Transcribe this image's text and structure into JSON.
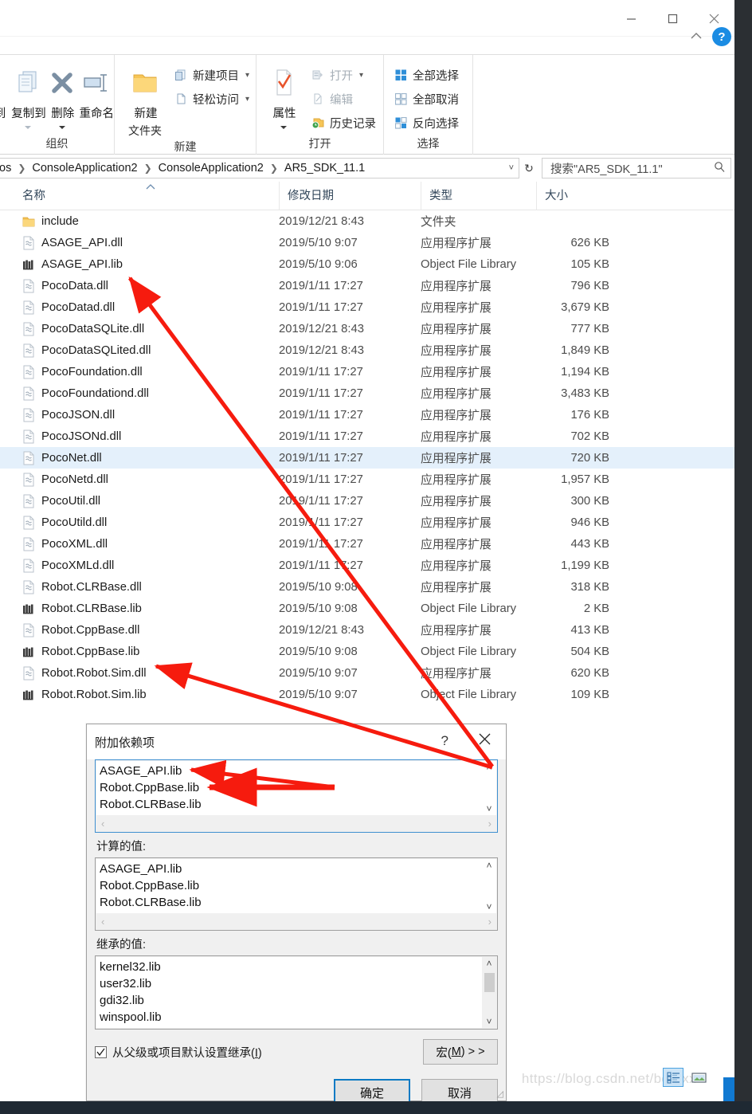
{
  "window": {
    "controls": {
      "minimize": "minimize-icon",
      "maximize": "maximize-icon",
      "close": "close-icon"
    },
    "collapse_ribbon": "chevron-up-icon",
    "help": "?"
  },
  "ribbon": {
    "groups": [
      {
        "label": "组织",
        "big_buttons": [
          {
            "name": "move-to",
            "label_line1": "到",
            "label_line2": "",
            "icon": "move-to-icon",
            "dropdown": true,
            "dim": true
          },
          {
            "name": "copy-to",
            "label_line1": "复制到",
            "label_line2": "",
            "icon": "copy-to-icon",
            "dropdown": true,
            "dim": true
          },
          {
            "name": "delete",
            "label_line1": "删除",
            "label_line2": "",
            "icon": "delete-x-icon",
            "dropdown": true,
            "dim": false
          },
          {
            "name": "rename",
            "label_line1": "重命名",
            "label_line2": "",
            "icon": "rename-icon",
            "dropdown": false,
            "dim": false
          }
        ]
      },
      {
        "label": "新建",
        "big_buttons": [
          {
            "name": "new-folder",
            "label_line1": "新建",
            "label_line2": "文件夹",
            "icon": "folder-icon",
            "dropdown": false,
            "dim": false
          }
        ],
        "small_buttons": [
          {
            "name": "new-item",
            "label": "新建项目",
            "icon": "new-item-icon",
            "dropdown": true,
            "dim": false
          },
          {
            "name": "easy-access",
            "label": "轻松访问",
            "icon": "easy-access-icon",
            "dropdown": true,
            "dim": false
          }
        ]
      },
      {
        "label": "打开",
        "big_buttons": [
          {
            "name": "properties",
            "label_line1": "属性",
            "label_line2": "",
            "icon": "properties-icon",
            "dropdown": true,
            "dim": false
          }
        ],
        "small_buttons": [
          {
            "name": "open",
            "label": "打开",
            "icon": "open-icon",
            "dropdown": true,
            "dim": true
          },
          {
            "name": "edit",
            "label": "编辑",
            "icon": "edit-icon",
            "dropdown": false,
            "dim": true
          },
          {
            "name": "history",
            "label": "历史记录",
            "icon": "history-icon",
            "dropdown": false,
            "dim": false
          }
        ]
      },
      {
        "label": "选择",
        "small_buttons": [
          {
            "name": "select-all",
            "label": "全部选择",
            "icon": "select-all-icon",
            "dropdown": false,
            "dim": false
          },
          {
            "name": "select-none",
            "label": "全部取消",
            "icon": "select-none-icon",
            "dropdown": false,
            "dim": false
          },
          {
            "name": "invert-selection",
            "label": "反向选择",
            "icon": "invert-selection-icon",
            "dropdown": false,
            "dim": false
          }
        ]
      }
    ]
  },
  "address_bar": {
    "crumbs": [
      "os",
      "ConsoleApplication2",
      "ConsoleApplication2",
      "AR5_SDK_11.1"
    ],
    "dropdown_icon": "chevron-down-icon",
    "refresh_icon": "refresh-icon"
  },
  "search": {
    "value": "搜索\"AR5_SDK_11.1\"",
    "icon": "search-icon"
  },
  "columns": [
    {
      "key": "name",
      "label": "名称",
      "sorted": true,
      "sort_dir": "asc"
    },
    {
      "key": "date",
      "label": "修改日期"
    },
    {
      "key": "type",
      "label": "类型"
    },
    {
      "key": "size",
      "label": "大小"
    }
  ],
  "files": [
    {
      "name": "include",
      "date": "2019/12/21 8:43",
      "type": "文件夹",
      "size": "",
      "icon": "folder-icon",
      "selected": false
    },
    {
      "name": "ASAGE_API.dll",
      "date": "2019/5/10 9:07",
      "type": "应用程序扩展",
      "size": "626 KB",
      "icon": "dll-icon",
      "selected": false
    },
    {
      "name": "ASAGE_API.lib",
      "date": "2019/5/10 9:06",
      "type": "Object File Library",
      "size": "105 KB",
      "icon": "lib-icon",
      "selected": false
    },
    {
      "name": "PocoData.dll",
      "date": "2019/1/11 17:27",
      "type": "应用程序扩展",
      "size": "796 KB",
      "icon": "dll-icon",
      "selected": false
    },
    {
      "name": "PocoDatad.dll",
      "date": "2019/1/11 17:27",
      "type": "应用程序扩展",
      "size": "3,679 KB",
      "icon": "dll-icon",
      "selected": false
    },
    {
      "name": "PocoDataSQLite.dll",
      "date": "2019/12/21 8:43",
      "type": "应用程序扩展",
      "size": "777 KB",
      "icon": "dll-icon",
      "selected": false
    },
    {
      "name": "PocoDataSQLited.dll",
      "date": "2019/12/21 8:43",
      "type": "应用程序扩展",
      "size": "1,849 KB",
      "icon": "dll-icon",
      "selected": false
    },
    {
      "name": "PocoFoundation.dll",
      "date": "2019/1/11 17:27",
      "type": "应用程序扩展",
      "size": "1,194 KB",
      "icon": "dll-icon",
      "selected": false
    },
    {
      "name": "PocoFoundationd.dll",
      "date": "2019/1/11 17:27",
      "type": "应用程序扩展",
      "size": "3,483 KB",
      "icon": "dll-icon",
      "selected": false
    },
    {
      "name": "PocoJSON.dll",
      "date": "2019/1/11 17:27",
      "type": "应用程序扩展",
      "size": "176 KB",
      "icon": "dll-icon",
      "selected": false
    },
    {
      "name": "PocoJSONd.dll",
      "date": "2019/1/11 17:27",
      "type": "应用程序扩展",
      "size": "702 KB",
      "icon": "dll-icon",
      "selected": false
    },
    {
      "name": "PocoNet.dll",
      "date": "2019/1/11 17:27",
      "type": "应用程序扩展",
      "size": "720 KB",
      "icon": "dll-icon",
      "selected": true
    },
    {
      "name": "PocoNetd.dll",
      "date": "2019/1/11 17:27",
      "type": "应用程序扩展",
      "size": "1,957 KB",
      "icon": "dll-icon",
      "selected": false
    },
    {
      "name": "PocoUtil.dll",
      "date": "2019/1/11 17:27",
      "type": "应用程序扩展",
      "size": "300 KB",
      "icon": "dll-icon",
      "selected": false
    },
    {
      "name": "PocoUtild.dll",
      "date": "2019/1/11 17:27",
      "type": "应用程序扩展",
      "size": "946 KB",
      "icon": "dll-icon",
      "selected": false
    },
    {
      "name": "PocoXML.dll",
      "date": "2019/1/11 17:27",
      "type": "应用程序扩展",
      "size": "443 KB",
      "icon": "dll-icon",
      "selected": false
    },
    {
      "name": "PocoXMLd.dll",
      "date": "2019/1/11 17:27",
      "type": "应用程序扩展",
      "size": "1,199 KB",
      "icon": "dll-icon",
      "selected": false
    },
    {
      "name": "Robot.CLRBase.dll",
      "date": "2019/5/10 9:08",
      "type": "应用程序扩展",
      "size": "318 KB",
      "icon": "dll-icon",
      "selected": false
    },
    {
      "name": "Robot.CLRBase.lib",
      "date": "2019/5/10 9:08",
      "type": "Object File Library",
      "size": "2 KB",
      "icon": "lib-icon",
      "selected": false
    },
    {
      "name": "Robot.CppBase.dll",
      "date": "2019/12/21 8:43",
      "type": "应用程序扩展",
      "size": "413 KB",
      "icon": "dll-icon",
      "selected": false
    },
    {
      "name": "Robot.CppBase.lib",
      "date": "2019/5/10 9:08",
      "type": "Object File Library",
      "size": "504 KB",
      "icon": "lib-icon",
      "selected": false
    },
    {
      "name": "Robot.Robot.Sim.dll",
      "date": "2019/5/10 9:07",
      "type": "应用程序扩展",
      "size": "620 KB",
      "icon": "dll-icon",
      "selected": false
    },
    {
      "name": "Robot.Robot.Sim.lib",
      "date": "2019/5/10 9:07",
      "type": "Object File Library",
      "size": "109 KB",
      "icon": "lib-icon",
      "selected": false
    }
  ],
  "view_buttons": [
    {
      "name": "details-view",
      "icon": "details-view-icon",
      "active": true
    },
    {
      "name": "large-icons-view",
      "icon": "large-icons-view-icon",
      "active": false
    }
  ],
  "watermark": "https://blog.csdn.net/bornxx",
  "dialog": {
    "title": "附加依赖项",
    "help_glyph": "?",
    "close_icon": "close-icon",
    "edit_field": {
      "items": [
        "ASAGE_API.lib",
        "Robot.CppBase.lib",
        "Robot.CLRBase.lib"
      ],
      "scroll_up": "chevron-up-icon",
      "scroll_down": "chevron-down-icon",
      "h_left": "chevron-left-icon",
      "h_right": "chevron-right-icon"
    },
    "evaluated": {
      "label": "计算的值:",
      "items": [
        "ASAGE_API.lib",
        "Robot.CppBase.lib",
        "Robot.CLRBase.lib"
      ],
      "scroll_up": "chevron-up-icon",
      "scroll_down": "chevron-down-icon",
      "h_left": "chevron-left-icon",
      "h_right": "chevron-right-icon"
    },
    "inherited": {
      "label": "继承的值:",
      "items": [
        "kernel32.lib",
        "user32.lib",
        "gdi32.lib",
        "winspool.lib"
      ],
      "scroll_up": "chevron-up-icon",
      "scroll_down": "chevron-down-icon"
    },
    "checkbox": {
      "label_pre": "从父级或项目默认设置继承(",
      "label_key": "I",
      "label_post": ")",
      "checked": true
    },
    "macro_button": {
      "label_pre": "宏(",
      "label_key": "M",
      "label_post": ") > >"
    },
    "ok_button": "确定",
    "cancel_button": "取消"
  },
  "colors": {
    "accent": "#0b7ac4",
    "selection": "#e4f0fb",
    "annotation_red": "#f61b0e",
    "taskbar": "#1f2933"
  }
}
